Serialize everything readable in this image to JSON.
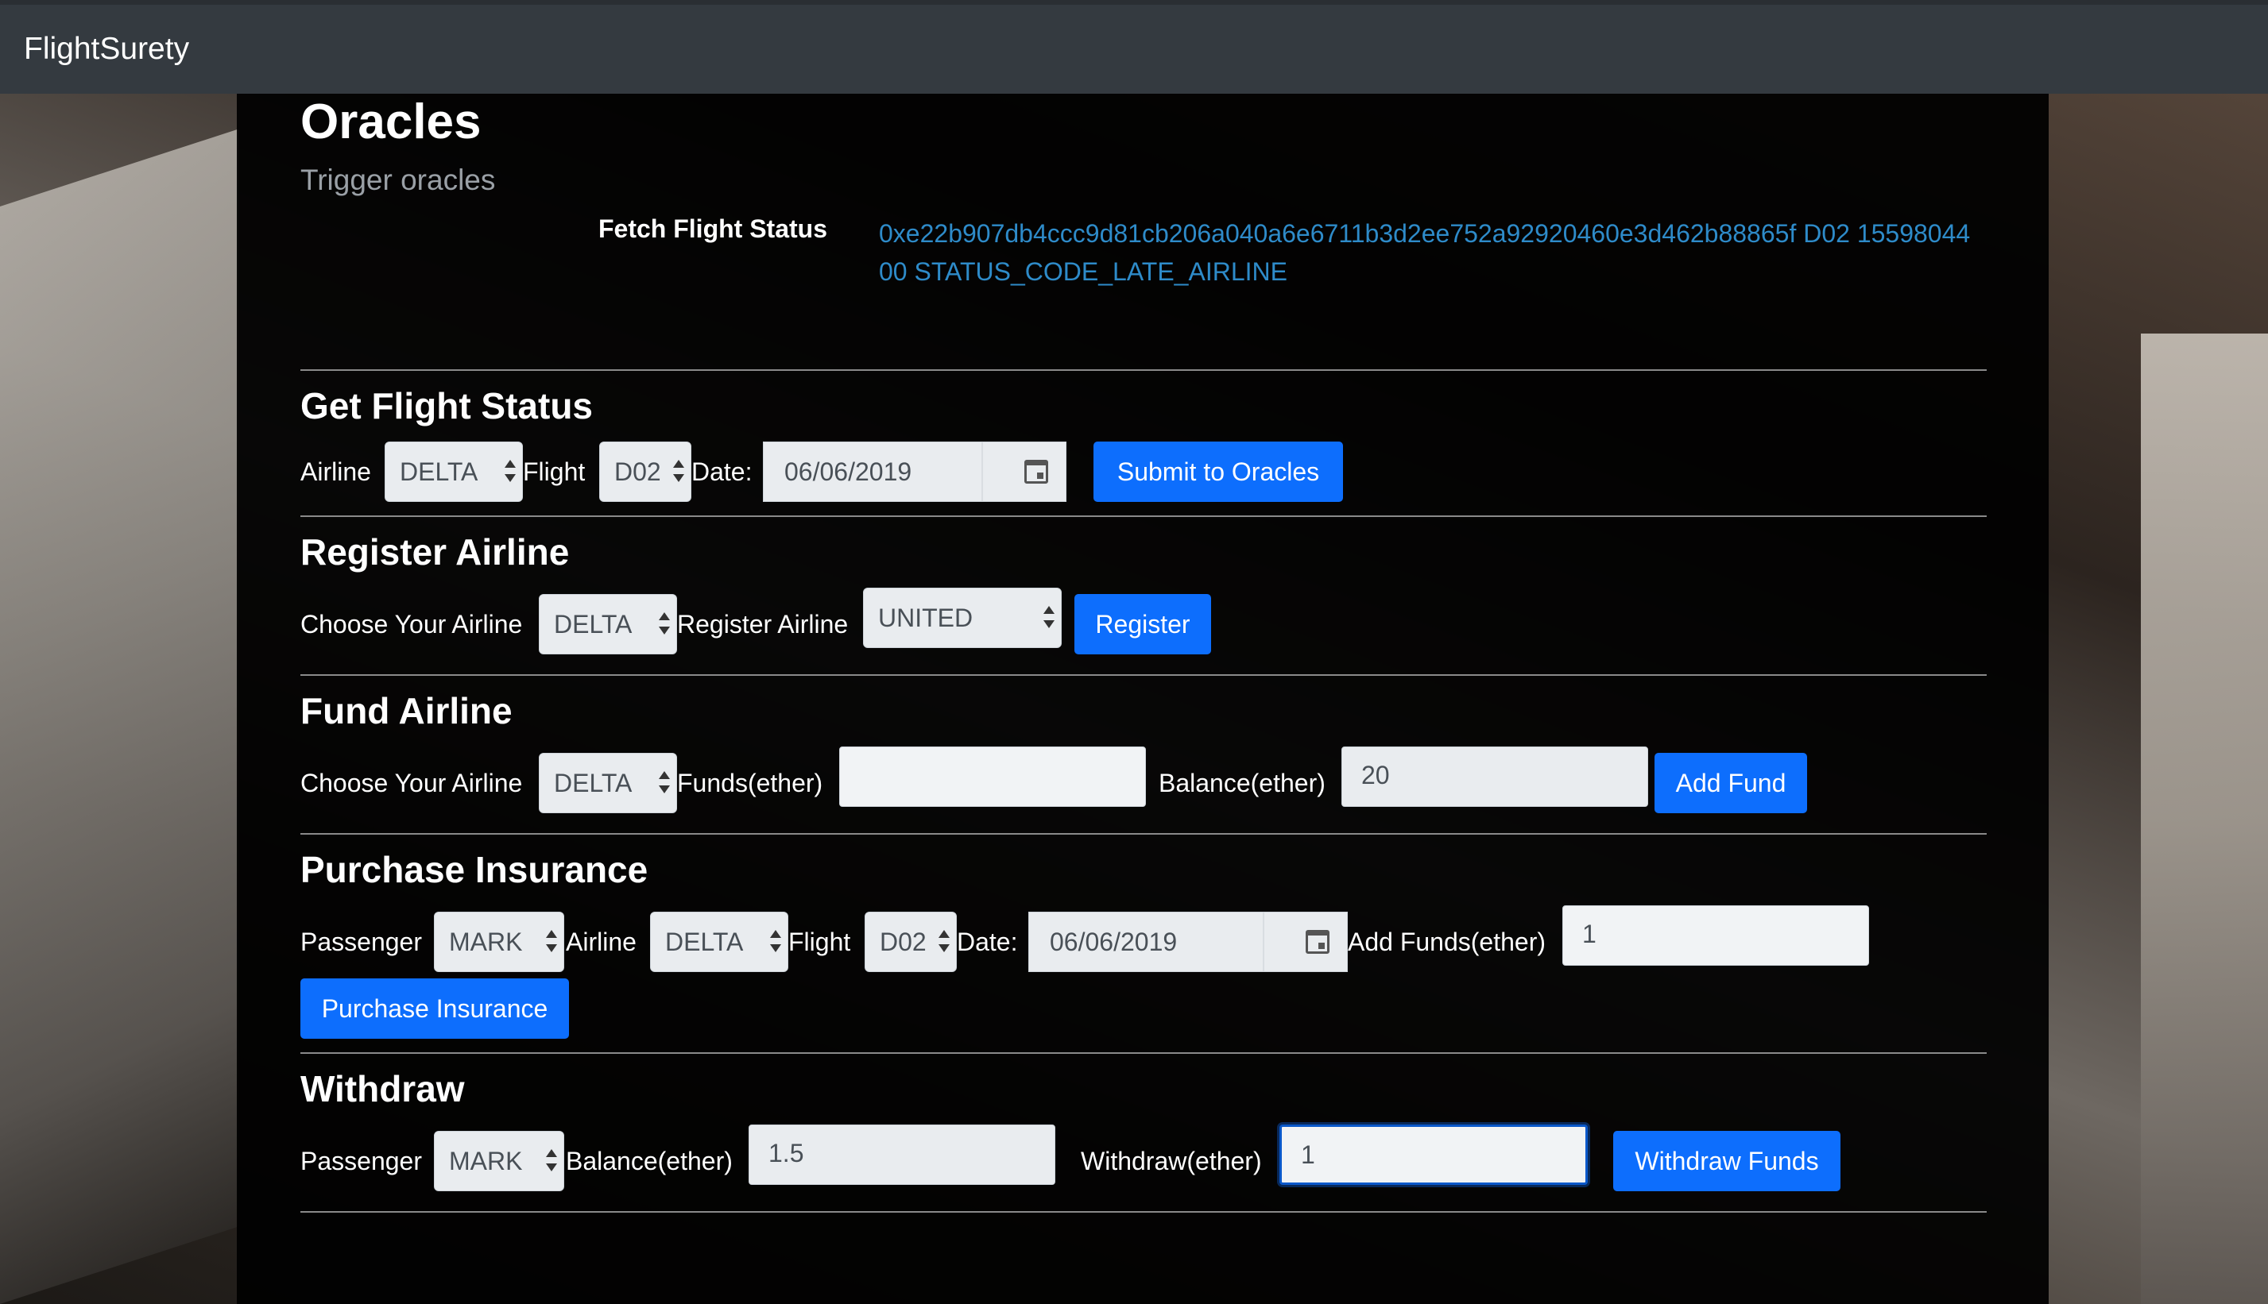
{
  "app": {
    "brand": "FlightSurety"
  },
  "oracles": {
    "title": "Oracles",
    "subtitle": "Trigger oracles",
    "fetch_label": "Fetch Flight Status",
    "fetch_value": "0xe22b907db4ccc9d81cb206a040a6e6711b3d2ee752a92920460e3d462b88865f D02 1559804400 STATUS_CODE_LATE_AIRLINE"
  },
  "get_flight_status": {
    "title": "Get Flight Status",
    "airline_label": "Airline",
    "airline_value": "DELTA",
    "flight_label": "Flight",
    "flight_value": "D02",
    "date_label": "Date:",
    "date_value": "06/06/2019",
    "submit_label": "Submit to Oracles"
  },
  "register_airline": {
    "title": "Register Airline",
    "choose_label": "Choose Your Airline",
    "choose_value": "DELTA",
    "register_label": "Register Airline",
    "register_value": "UNITED",
    "button_label": "Register"
  },
  "fund_airline": {
    "title": "Fund Airline",
    "choose_label": "Choose Your Airline",
    "choose_value": "DELTA",
    "funds_label": "Funds(ether)",
    "funds_value": "",
    "balance_label": "Balance(ether)",
    "balance_value": "20",
    "button_label": "Add Fund"
  },
  "purchase_insurance": {
    "title": "Purchase Insurance",
    "passenger_label": "Passenger",
    "passenger_value": "MARK",
    "airline_label": "Airline",
    "airline_value": "DELTA",
    "flight_label": "Flight",
    "flight_value": "D02",
    "date_label": "Date:",
    "date_value": "06/06/2019",
    "add_funds_label": "Add Funds(ether)",
    "add_funds_value": "1",
    "button_label": "Purchase Insurance"
  },
  "withdraw": {
    "title": "Withdraw",
    "passenger_label": "Passenger",
    "passenger_value": "MARK",
    "balance_label": "Balance(ether)",
    "balance_value": "1.5",
    "withdraw_label": "Withdraw(ether)",
    "withdraw_value": "1",
    "button_label": "Withdraw Funds"
  }
}
